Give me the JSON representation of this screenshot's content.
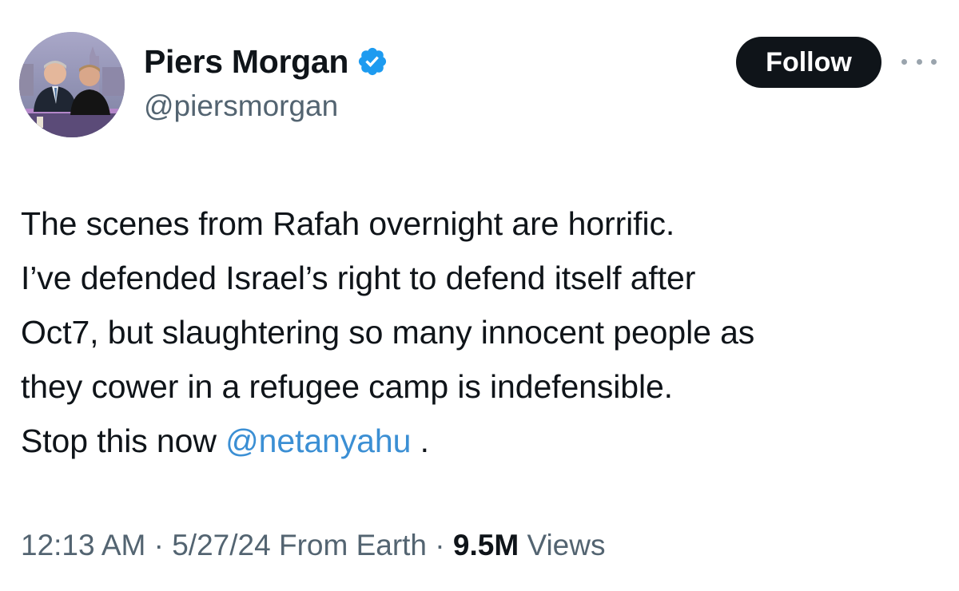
{
  "author": {
    "display_name": "Piers Morgan",
    "handle": "@piersmorgan",
    "verified": true,
    "verified_badge_color": "#1d9bf0",
    "avatar_icon": "profile-photo"
  },
  "actions": {
    "follow_label": "Follow",
    "more_icon": "more-horizontal-icon"
  },
  "tweet": {
    "lines": [
      "The scenes from Rafah overnight are horrific.",
      "I’ve defended Israel’s right to defend itself after",
      "Oct7, but slaughtering so many innocent people as",
      "they cower in a refugee camp is indefensible."
    ],
    "last_line_prefix": "Stop this now ",
    "mention": "@netanyahu",
    "last_line_suffix": " ."
  },
  "meta": {
    "time": "12:13 AM",
    "separator": " · ",
    "date": "5/27/24",
    "location": "From Earth",
    "views_count": "9.5M",
    "views_label": "Views"
  },
  "colors": {
    "text": "#0f1419",
    "secondary": "#536471",
    "link": "#3b8fd4",
    "follow_bg": "#0f1419"
  }
}
